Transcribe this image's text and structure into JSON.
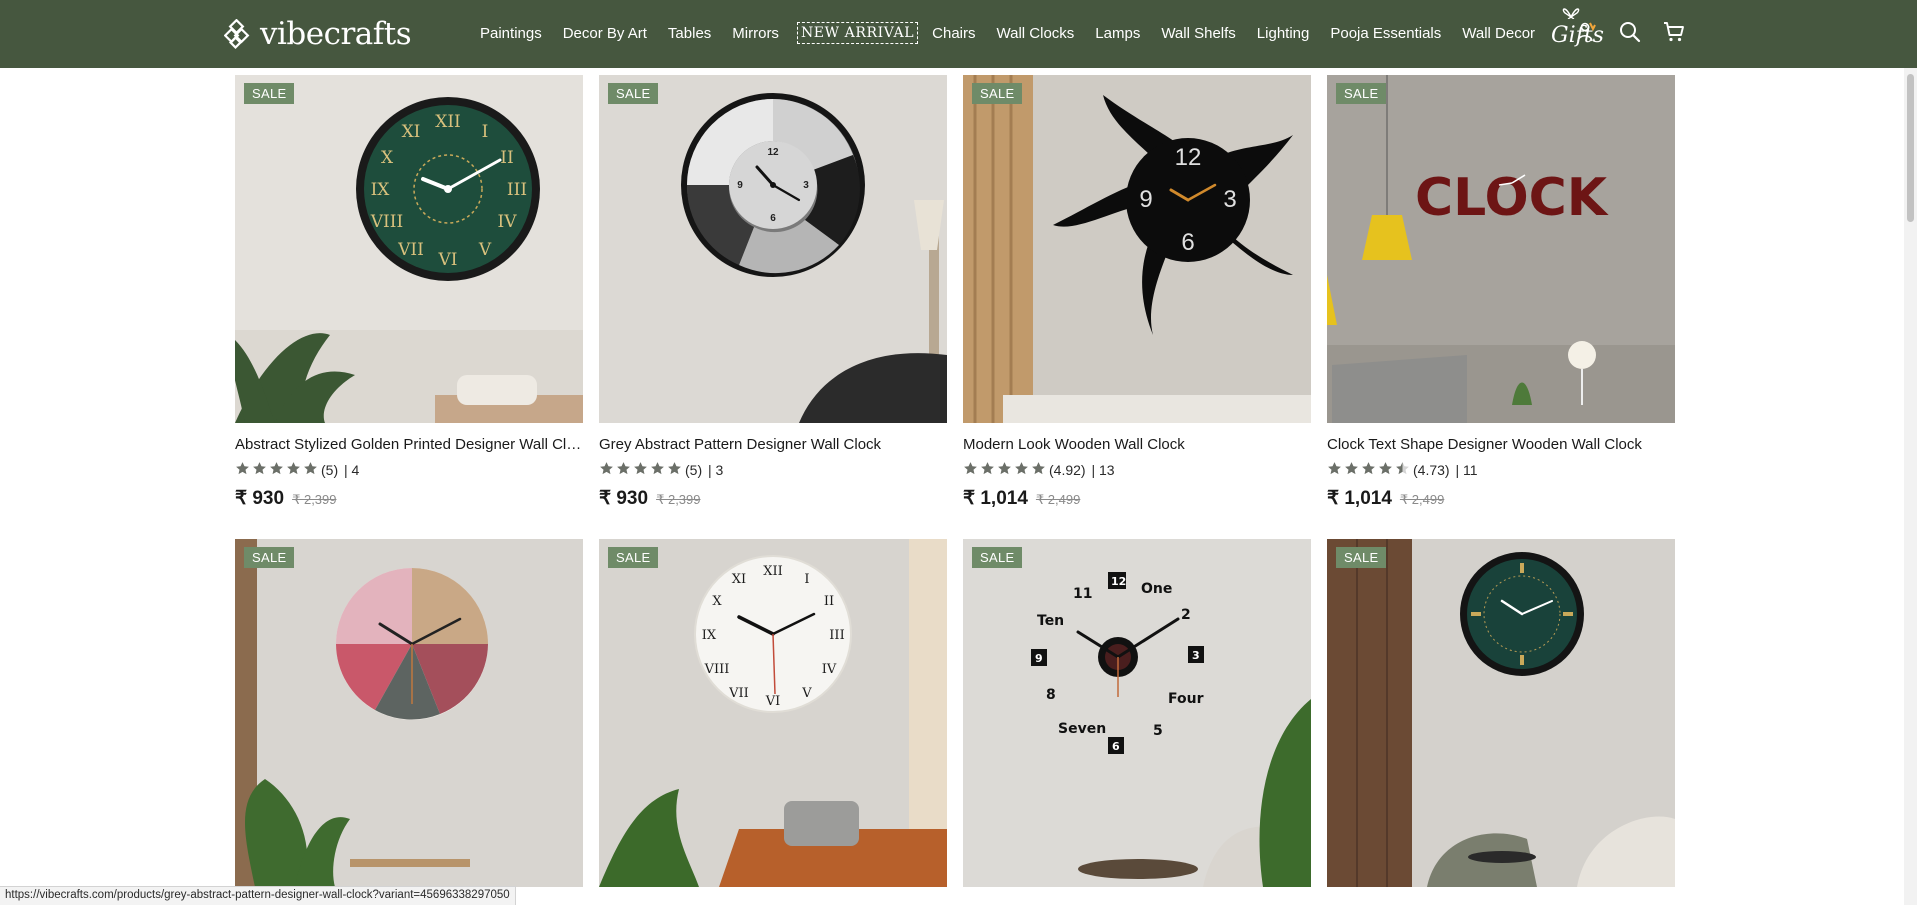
{
  "brand": {
    "name": "vibecrafts"
  },
  "nav": [
    {
      "label": "Paintings"
    },
    {
      "label": "Decor By Art"
    },
    {
      "label": "Tables"
    },
    {
      "label": "Mirrors"
    },
    {
      "label": "NEW ARRIVAL"
    },
    {
      "label": "Chairs"
    },
    {
      "label": "Wall Clocks"
    },
    {
      "label": "Lamps"
    },
    {
      "label": "Wall Shelfs"
    },
    {
      "label": "Lighting"
    },
    {
      "label": "Pooja Essentials"
    },
    {
      "label": "Wall Decor"
    }
  ],
  "gifts_label": "Gifts",
  "header_icons": [
    "user-account-icon",
    "search-icon",
    "cart-icon"
  ],
  "colors": {
    "header_bg": "#46573f",
    "sale_badge": "#6f8b68",
    "star": "#6b6f68"
  },
  "products": [
    {
      "title": "Abstract Stylized Golden Printed Designer Wall Clock",
      "sale": "SALE",
      "rating": "(5)",
      "reviews": "| 4",
      "stars": 5,
      "price": "₹ 930",
      "compare": "₹ 2,399"
    },
    {
      "title": "Grey Abstract Pattern Designer Wall Clock",
      "sale": "SALE",
      "rating": "(5)",
      "reviews": "| 3",
      "stars": 5,
      "price": "₹ 930",
      "compare": "₹ 2,399"
    },
    {
      "title": "Modern Look Wooden Wall Clock",
      "sale": "SALE",
      "rating": "(4.92)",
      "reviews": "| 13",
      "stars": 5,
      "price": "₹ 1,014",
      "compare": "₹ 2,499"
    },
    {
      "title": "Clock Text Shape Designer Wooden Wall Clock",
      "sale": "SALE",
      "rating": "(4.73)",
      "reviews": "| 11",
      "stars": 4.5,
      "price": "₹ 1,014",
      "compare": "₹ 2,499"
    },
    {
      "sale": "SALE"
    },
    {
      "sale": "SALE"
    },
    {
      "sale": "SALE"
    },
    {
      "sale": "SALE"
    }
  ],
  "image_text": {
    "clock_text_sign": "CLOCK",
    "p7_words": [
      "12",
      "One",
      "2",
      "3",
      "Four",
      "5",
      "6",
      "Seven",
      "8",
      "9",
      "Ten",
      "11"
    ]
  },
  "status_url": "https://vibecrafts.com/products/grey-abstract-pattern-designer-wall-clock?variant=45696338297050"
}
